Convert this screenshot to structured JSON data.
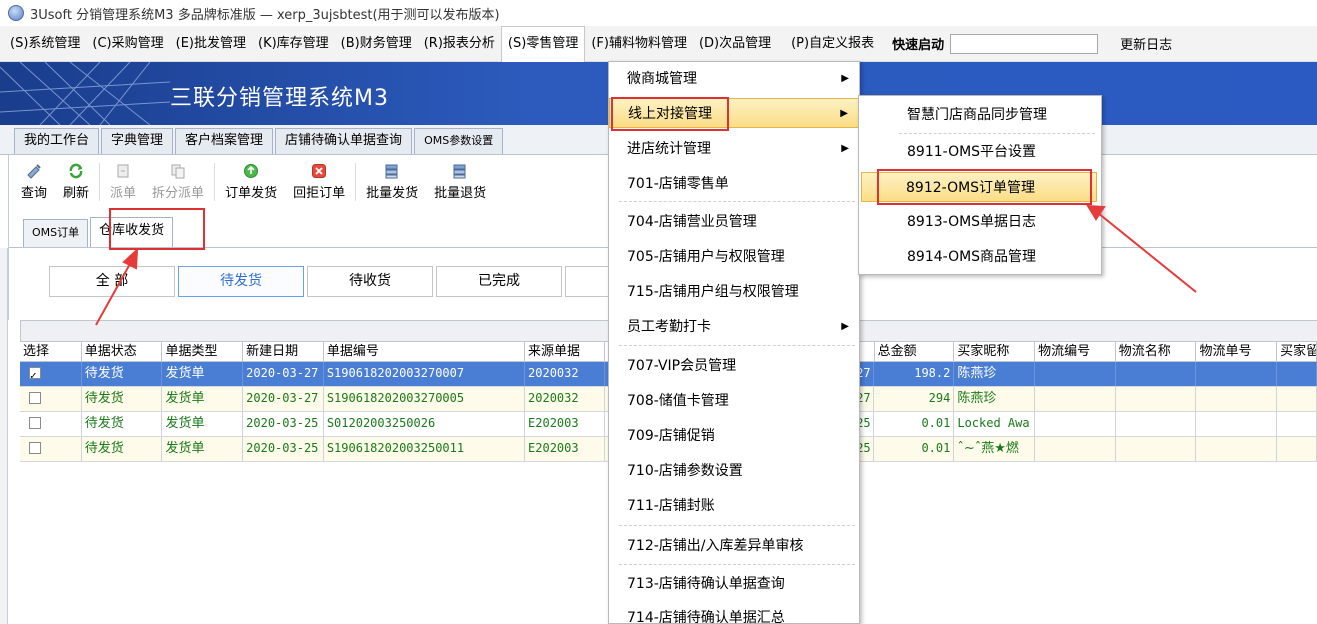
{
  "window": {
    "title": "3Usoft 分销管理系统M3 多品牌标准版 — xerp_3ujsbtest(用于测可以发布版本)"
  },
  "menubar": {
    "items": [
      "(S)系统管理",
      "(C)采购管理",
      "(E)批发管理",
      "(K)库存管理",
      "(B)财务管理",
      "(R)报表分析",
      "(S)零售管理",
      "(F)辅料物料管理",
      "(D)次品管理",
      "(P)自定义报表"
    ],
    "quick_start": "快速启动",
    "update_log": "更新日志"
  },
  "banner": {
    "title": "三联分销管理系统M3"
  },
  "workspace_tabs": [
    "我的工作台",
    "字典管理",
    "客户档案管理",
    "店铺待确认单据查询",
    "OMS参数设置"
  ],
  "toolbar": {
    "buttons": [
      "查询",
      "刷新",
      "派单",
      "拆分派单",
      "订单发货",
      "回拒订单",
      "批量发货",
      "批量退货"
    ]
  },
  "subtabs": [
    "OMS订单",
    "仓库收发货"
  ],
  "filters": [
    "全 部",
    "待发货",
    "待收货",
    "已完成"
  ],
  "grid": {
    "columns": [
      "选择",
      "单据状态",
      "单据类型",
      "新建日期",
      "单据编号",
      "来源单据",
      "总金额",
      "买家昵称",
      "物流编号",
      "物流名称",
      "物流单号",
      "买家留言"
    ],
    "rows": [
      {
        "checked": true,
        "status": "待发货",
        "type": "发货单",
        "date": "2020-03-27",
        "number": "S190618202003270007",
        "source": "2020032",
        "source_tail": "27",
        "amount": "198.2",
        "buyer": "陈燕珍"
      },
      {
        "checked": false,
        "status": "待发货",
        "type": "发货单",
        "date": "2020-03-27",
        "number": "S190618202003270005",
        "source": "2020032",
        "source_tail": "27",
        "amount": "294",
        "buyer": "陈燕珍"
      },
      {
        "checked": false,
        "status": "待发货",
        "type": "发货单",
        "date": "2020-03-25",
        "number": "S01202003250026",
        "source": "E202003",
        "source_tail": "25",
        "amount": "0.01",
        "buyer": "Locked Awa"
      },
      {
        "checked": false,
        "status": "待发货",
        "type": "发货单",
        "date": "2020-03-25",
        "number": "S190618202003250011",
        "source": "E202003",
        "source_tail": "25",
        "amount": "0.01",
        "buyer": "ˆ~ˆ燕★燃"
      }
    ]
  },
  "retail_menu": {
    "items": [
      "微商城管理",
      "线上对接管理",
      "进店统计管理",
      "701-店铺零售单",
      "704-店铺营业员管理",
      "705-店铺用户与权限管理",
      "715-店铺用户组与权限管理",
      "员工考勤打卡",
      "707-VIP会员管理",
      "708-储值卡管理",
      "709-店铺促销",
      "710-店铺参数设置",
      "711-店铺封账",
      "712-店铺出/入库差异单审核",
      "713-店铺待确认单据查询",
      "714-店铺待确认单据汇总"
    ]
  },
  "online_submenu": {
    "items": [
      "智慧门店商品同步管理",
      "8911-OMS平台设置",
      "8912-OMS订单管理",
      "8913-OMS单据日志",
      "8914-OMS商品管理"
    ]
  },
  "colors": {
    "banner": "#2b5bc2",
    "highlight": "#fbdd86",
    "annotation": "#e03030",
    "selected_row": "#4a7ed4"
  }
}
